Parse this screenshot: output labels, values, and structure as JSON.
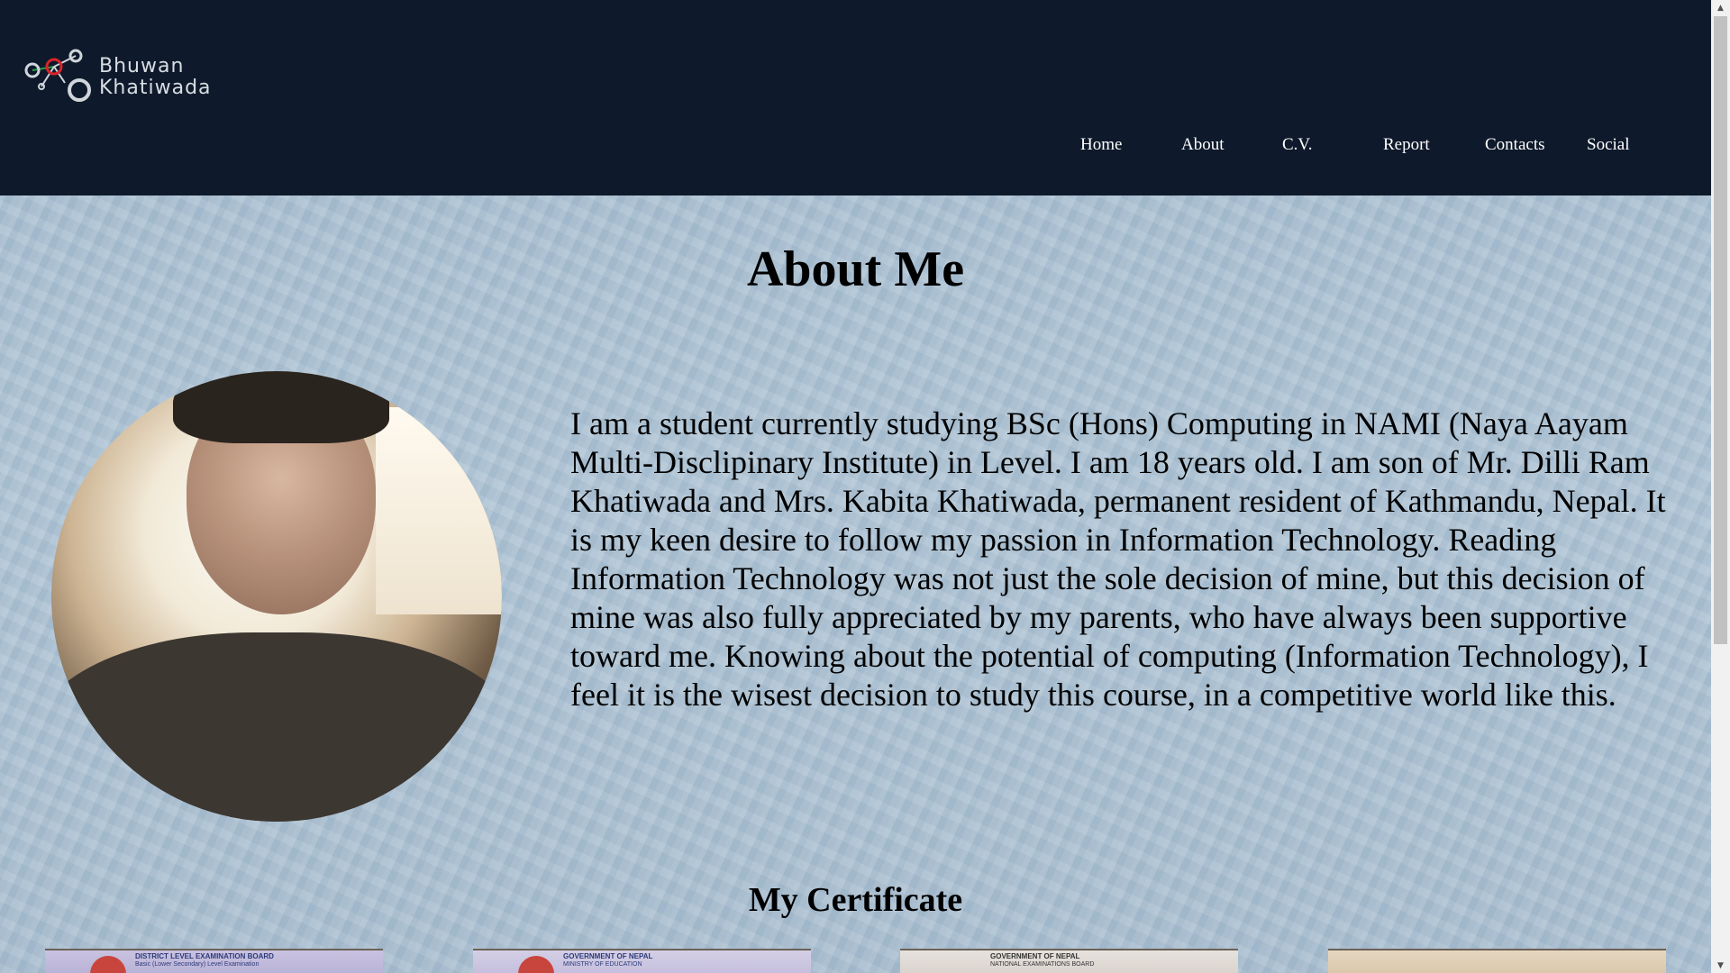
{
  "brand": {
    "logo_line1": "Bhuwan",
    "logo_line2": "Khatiwada",
    "colors": {
      "header_bg": "#0e1a2b",
      "logo_accent": "#d9242b",
      "logo_node": "#2e9b47"
    }
  },
  "nav": {
    "items": [
      {
        "label": "Home"
      },
      {
        "label": "About"
      },
      {
        "label": "C.V."
      },
      {
        "label": "Report"
      },
      {
        "label": "Contacts"
      },
      {
        "label": "Social"
      }
    ]
  },
  "about": {
    "title": "About Me",
    "photo_icon": "profile-photo",
    "paragraph": "I am a student currently studying BSc (Hons) Computing in NAMI (Naya Aayam Multi-Disclipinary Institute) in Level. I am 18 years old. I am son of Mr. Dilli Ram Khatiwada and Mrs. Kabita Khatiwada, permanent resident of Kathmandu, Nepal. It is my keen desire to follow my passion in Information Technology. Reading Information Technology was not just the sole decision of mine, but this decision of mine was also fully appreciated by my parents, who have always been supportive toward me. Knowing about the potential of computing (Information Technology), I feel it is the wisest decision to study this course, in a competitive world like this."
  },
  "certificates": {
    "title": "My Certificate",
    "items": [
      {
        "line1": "DISTRICT LEVEL EXAMINATION BOARD",
        "line2": "Basic (Lower Secondary) Level Examination"
      },
      {
        "line1": "GOVERNMENT OF NEPAL",
        "line2": "MINISTRY OF EDUCATION"
      },
      {
        "line1": "GOVERNMENT OF NEPAL",
        "line2": "NATIONAL EXAMINATIONS BOARD"
      },
      {
        "line1": "",
        "line2": ""
      }
    ]
  }
}
